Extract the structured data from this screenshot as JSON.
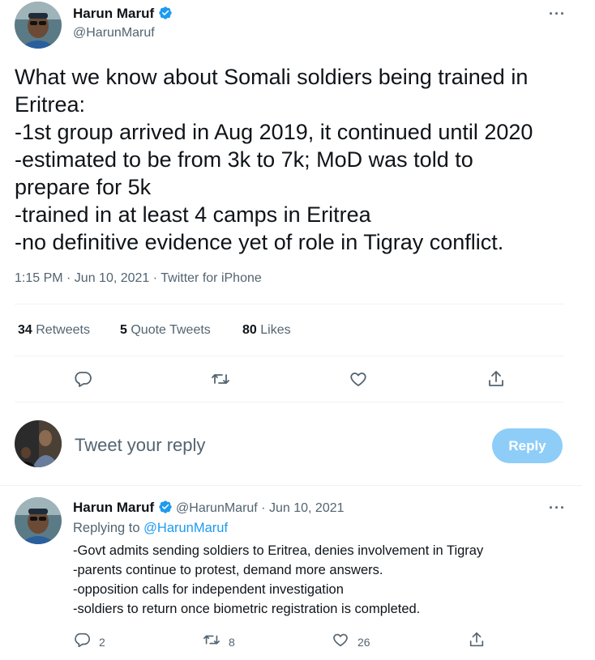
{
  "main_tweet": {
    "author_name": "Harun Maruf",
    "author_handle": "@HarunMaruf",
    "more_label": "···",
    "text": "What we know about Somali soldiers being trained in\nEritrea:\n-1st group arrived in Aug 2019, it continued until 2020\n-estimated to be from 3k to 7k; MoD was told to\nprepare for 5k\n-trained in at least 4 camps in Eritrea\n-no definitive evidence yet of role in Tigray conflict.",
    "timestamp": "1:15 PM · Jun 10, 2021 · Twitter for iPhone",
    "stats": {
      "retweets_count": "34",
      "retweets_label": "Retweets",
      "quotes_count": "5",
      "quotes_label": "Quote Tweets",
      "likes_count": "80",
      "likes_label": "Likes"
    },
    "icons": [
      "comment-icon",
      "retweet-icon",
      "like-icon",
      "share-icon"
    ]
  },
  "composer": {
    "placeholder": "Tweet your reply",
    "button_label": "Reply"
  },
  "reply_tweet": {
    "author_name": "Harun Maruf",
    "author_handle": "@HarunMaruf",
    "separator": "·",
    "date": "Jun 10, 2021",
    "more_label": "···",
    "replying_prefix": "Replying to",
    "replying_to": "@HarunMaruf",
    "text": "-Govt admits sending soldiers to Eritrea, denies involvement in Tigray\n-parents continue to protest, demand more answers.\n-opposition calls for independent investigation\n-soldiers to return once biometric registration is completed.",
    "reply_count": "2",
    "retweet_count": "8",
    "like_count": "26"
  },
  "colors": {
    "accent": "#1d9bf0",
    "reply_button_disabled": "#8ecdf8",
    "secondary_text": "#536471",
    "divider": "#eff3f4"
  }
}
